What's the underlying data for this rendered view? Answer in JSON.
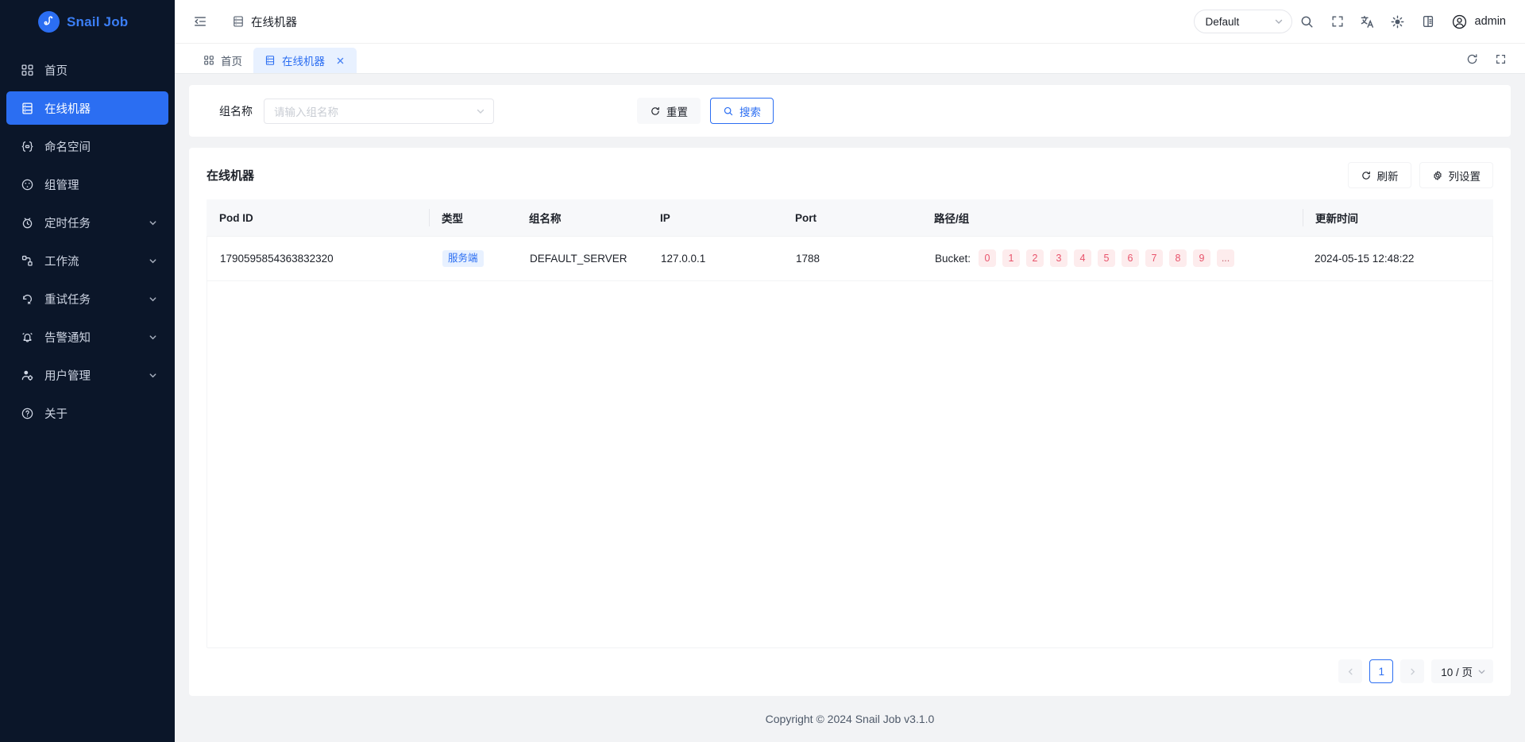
{
  "brand": {
    "name": "Snail Job",
    "logo_icon": "snail-logo-icon"
  },
  "sidebar": {
    "items": [
      {
        "label": "首页",
        "icon": "dashboard-icon",
        "active": false,
        "expandable": false
      },
      {
        "label": "在线机器",
        "icon": "server-icon",
        "active": true,
        "expandable": false
      },
      {
        "label": "命名空间",
        "icon": "namespace-icon",
        "active": false,
        "expandable": false
      },
      {
        "label": "组管理",
        "icon": "group-icon",
        "active": false,
        "expandable": false
      },
      {
        "label": "定时任务",
        "icon": "timer-icon",
        "active": false,
        "expandable": true
      },
      {
        "label": "工作流",
        "icon": "workflow-icon",
        "active": false,
        "expandable": true
      },
      {
        "label": "重试任务",
        "icon": "retry-icon",
        "active": false,
        "expandable": true
      },
      {
        "label": "告警通知",
        "icon": "bell-icon",
        "active": false,
        "expandable": true
      },
      {
        "label": "用户管理",
        "icon": "user-settings-icon",
        "active": false,
        "expandable": true
      },
      {
        "label": "关于",
        "icon": "question-circle-icon",
        "active": false,
        "expandable": false
      }
    ]
  },
  "header": {
    "collapse_icon": "menu-collapse-icon",
    "breadcrumb": "在线机器",
    "breadcrumb_icon": "server-icon",
    "theme_select": {
      "value": "Default",
      "arrow_icon": "chevron-down-icon"
    },
    "icons": [
      {
        "name": "search-icon"
      },
      {
        "name": "fullscreen-icon"
      },
      {
        "name": "translate-icon"
      },
      {
        "name": "theme-sun-icon"
      },
      {
        "name": "layout-settings-icon"
      }
    ],
    "user": {
      "name": "admin",
      "avatar_icon": "user-avatar-icon"
    }
  },
  "tabs": {
    "items": [
      {
        "label": "首页",
        "icon": "dashboard-icon",
        "active": false,
        "closable": false
      },
      {
        "label": "在线机器",
        "icon": "server-icon",
        "active": true,
        "closable": true
      }
    ],
    "close_icon": "close-icon",
    "right_icons": [
      {
        "name": "reload-icon"
      },
      {
        "name": "fullscreen-icon"
      }
    ]
  },
  "search": {
    "group_name_label": "组名称",
    "group_name_value": "",
    "group_name_placeholder": "请输入组名称",
    "group_name_arrow_icon": "chevron-down-icon",
    "reset_button": "重置",
    "reset_icon": "refresh-icon",
    "search_button": "搜索",
    "search_icon": "search-icon"
  },
  "table": {
    "title": "在线机器",
    "refresh_button": "刷新",
    "refresh_icon": "refresh-icon",
    "column_settings_button": "列设置",
    "column_settings_icon": "gear-icon",
    "columns": [
      {
        "key": "pod_id",
        "label": "Pod ID"
      },
      {
        "key": "type",
        "label": "类型"
      },
      {
        "key": "group_name",
        "label": "组名称"
      },
      {
        "key": "ip",
        "label": "IP"
      },
      {
        "key": "port",
        "label": "Port"
      },
      {
        "key": "path_group",
        "label": "路径/组"
      },
      {
        "key": "update_time",
        "label": "更新时间"
      }
    ],
    "rows": [
      {
        "pod_id": "1790595854363832320",
        "type": "服务端",
        "group_name": "DEFAULT_SERVER",
        "ip": "127.0.0.1",
        "port": "1788",
        "bucket_label": "Bucket:",
        "buckets": [
          "0",
          "1",
          "2",
          "3",
          "4",
          "5",
          "6",
          "7",
          "8",
          "9",
          "..."
        ],
        "update_time": "2024-05-15 12:48:22"
      }
    ]
  },
  "pagination": {
    "prev_icon": "chevron-left-icon",
    "next_icon": "chevron-right-icon",
    "current_page": "1",
    "page_size": "10 / 页",
    "page_size_arrow_icon": "chevron-down-icon"
  },
  "footer": {
    "copyright": "Copyright © 2024 Snail Job v3.1.0"
  },
  "colors": {
    "accent": "#2b6ef2",
    "sidebar_bg": "#0b1629",
    "badge_bg": "#e8f1ff",
    "bucket_bg": "#fdeced",
    "bucket_text": "#e8536b"
  }
}
